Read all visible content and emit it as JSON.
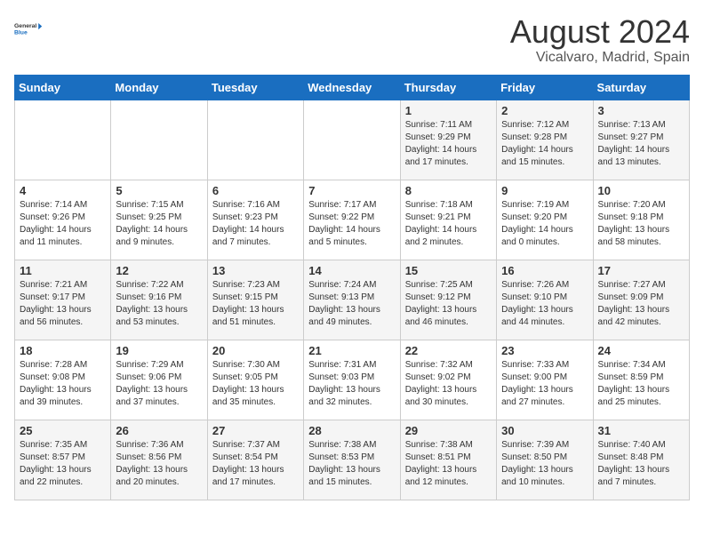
{
  "header": {
    "logo_line1": "General",
    "logo_line2": "Blue",
    "title": "August 2024",
    "subtitle": "Vicalvaro, Madrid, Spain"
  },
  "weekdays": [
    "Sunday",
    "Monday",
    "Tuesday",
    "Wednesday",
    "Thursday",
    "Friday",
    "Saturday"
  ],
  "weeks": [
    [
      {
        "day": "",
        "info": ""
      },
      {
        "day": "",
        "info": ""
      },
      {
        "day": "",
        "info": ""
      },
      {
        "day": "",
        "info": ""
      },
      {
        "day": "1",
        "info": "Sunrise: 7:11 AM\nSunset: 9:29 PM\nDaylight: 14 hours\nand 17 minutes."
      },
      {
        "day": "2",
        "info": "Sunrise: 7:12 AM\nSunset: 9:28 PM\nDaylight: 14 hours\nand 15 minutes."
      },
      {
        "day": "3",
        "info": "Sunrise: 7:13 AM\nSunset: 9:27 PM\nDaylight: 14 hours\nand 13 minutes."
      }
    ],
    [
      {
        "day": "4",
        "info": "Sunrise: 7:14 AM\nSunset: 9:26 PM\nDaylight: 14 hours\nand 11 minutes."
      },
      {
        "day": "5",
        "info": "Sunrise: 7:15 AM\nSunset: 9:25 PM\nDaylight: 14 hours\nand 9 minutes."
      },
      {
        "day": "6",
        "info": "Sunrise: 7:16 AM\nSunset: 9:23 PM\nDaylight: 14 hours\nand 7 minutes."
      },
      {
        "day": "7",
        "info": "Sunrise: 7:17 AM\nSunset: 9:22 PM\nDaylight: 14 hours\nand 5 minutes."
      },
      {
        "day": "8",
        "info": "Sunrise: 7:18 AM\nSunset: 9:21 PM\nDaylight: 14 hours\nand 2 minutes."
      },
      {
        "day": "9",
        "info": "Sunrise: 7:19 AM\nSunset: 9:20 PM\nDaylight: 14 hours\nand 0 minutes."
      },
      {
        "day": "10",
        "info": "Sunrise: 7:20 AM\nSunset: 9:18 PM\nDaylight: 13 hours\nand 58 minutes."
      }
    ],
    [
      {
        "day": "11",
        "info": "Sunrise: 7:21 AM\nSunset: 9:17 PM\nDaylight: 13 hours\nand 56 minutes."
      },
      {
        "day": "12",
        "info": "Sunrise: 7:22 AM\nSunset: 9:16 PM\nDaylight: 13 hours\nand 53 minutes."
      },
      {
        "day": "13",
        "info": "Sunrise: 7:23 AM\nSunset: 9:15 PM\nDaylight: 13 hours\nand 51 minutes."
      },
      {
        "day": "14",
        "info": "Sunrise: 7:24 AM\nSunset: 9:13 PM\nDaylight: 13 hours\nand 49 minutes."
      },
      {
        "day": "15",
        "info": "Sunrise: 7:25 AM\nSunset: 9:12 PM\nDaylight: 13 hours\nand 46 minutes."
      },
      {
        "day": "16",
        "info": "Sunrise: 7:26 AM\nSunset: 9:10 PM\nDaylight: 13 hours\nand 44 minutes."
      },
      {
        "day": "17",
        "info": "Sunrise: 7:27 AM\nSunset: 9:09 PM\nDaylight: 13 hours\nand 42 minutes."
      }
    ],
    [
      {
        "day": "18",
        "info": "Sunrise: 7:28 AM\nSunset: 9:08 PM\nDaylight: 13 hours\nand 39 minutes."
      },
      {
        "day": "19",
        "info": "Sunrise: 7:29 AM\nSunset: 9:06 PM\nDaylight: 13 hours\nand 37 minutes."
      },
      {
        "day": "20",
        "info": "Sunrise: 7:30 AM\nSunset: 9:05 PM\nDaylight: 13 hours\nand 35 minutes."
      },
      {
        "day": "21",
        "info": "Sunrise: 7:31 AM\nSunset: 9:03 PM\nDaylight: 13 hours\nand 32 minutes."
      },
      {
        "day": "22",
        "info": "Sunrise: 7:32 AM\nSunset: 9:02 PM\nDaylight: 13 hours\nand 30 minutes."
      },
      {
        "day": "23",
        "info": "Sunrise: 7:33 AM\nSunset: 9:00 PM\nDaylight: 13 hours\nand 27 minutes."
      },
      {
        "day": "24",
        "info": "Sunrise: 7:34 AM\nSunset: 8:59 PM\nDaylight: 13 hours\nand 25 minutes."
      }
    ],
    [
      {
        "day": "25",
        "info": "Sunrise: 7:35 AM\nSunset: 8:57 PM\nDaylight: 13 hours\nand 22 minutes."
      },
      {
        "day": "26",
        "info": "Sunrise: 7:36 AM\nSunset: 8:56 PM\nDaylight: 13 hours\nand 20 minutes."
      },
      {
        "day": "27",
        "info": "Sunrise: 7:37 AM\nSunset: 8:54 PM\nDaylight: 13 hours\nand 17 minutes."
      },
      {
        "day": "28",
        "info": "Sunrise: 7:38 AM\nSunset: 8:53 PM\nDaylight: 13 hours\nand 15 minutes."
      },
      {
        "day": "29",
        "info": "Sunrise: 7:38 AM\nSunset: 8:51 PM\nDaylight: 13 hours\nand 12 minutes."
      },
      {
        "day": "30",
        "info": "Sunrise: 7:39 AM\nSunset: 8:50 PM\nDaylight: 13 hours\nand 10 minutes."
      },
      {
        "day": "31",
        "info": "Sunrise: 7:40 AM\nSunset: 8:48 PM\nDaylight: 13 hours\nand 7 minutes."
      }
    ]
  ]
}
